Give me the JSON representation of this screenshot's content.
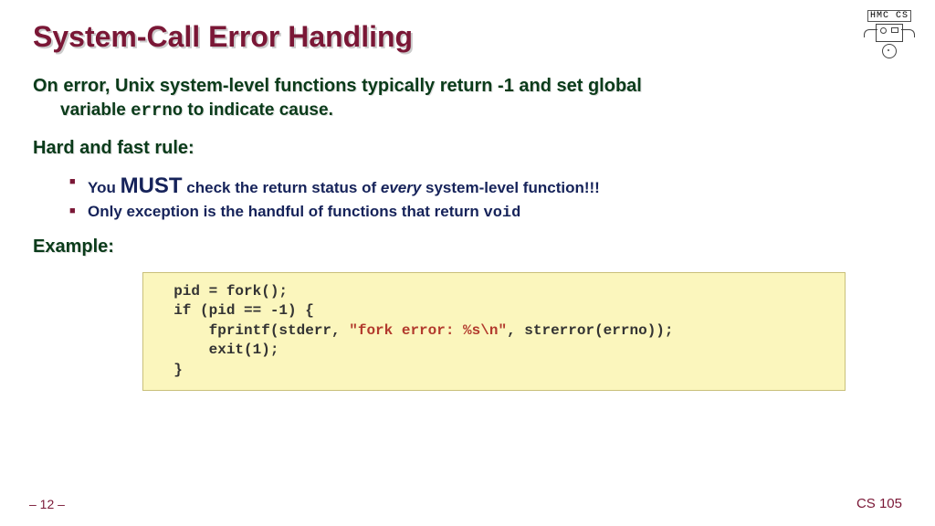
{
  "logo_label": "HMC CS",
  "title": "System-Call Error Handling",
  "para1_a": "On error, Unix system-level functions typically return -1 and set global",
  "para1_b_pre": "variable ",
  "para1_b_mono": "errno",
  "para1_b_post": " to indicate cause.",
  "hard_rule": "Hard and fast rule:",
  "bullet1_a": "You ",
  "bullet1_big": "MUST",
  "bullet1_b": " check the return status of ",
  "bullet1_em": "every",
  "bullet1_c": " system-level function!!!",
  "bullet2_a": "Only exception is the handful of functions that return ",
  "bullet2_mono": "void",
  "example": "Example:",
  "code_l1": "  pid = fork();",
  "code_l2": "  if (pid == -1) {",
  "code_l3a": "      fprintf(stderr, ",
  "code_l3s": "\"fork error: %s\\n\"",
  "code_l3b": ", strerror(errno));",
  "code_l4": "      exit(1);",
  "code_l5": "  }",
  "footer_left": "– 12 –",
  "footer_right": "CS 105"
}
